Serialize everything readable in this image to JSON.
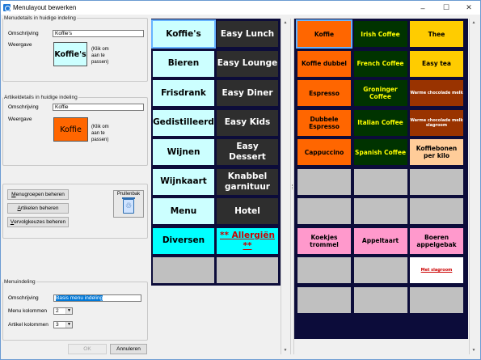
{
  "window": {
    "title": "Menulayout bewerken",
    "controls": {
      "minimize": "–",
      "maximize": "☐",
      "close": "✕"
    }
  },
  "menu_details": {
    "legend": "Menudetails in huidige indeling",
    "description_label": "Omschrijving",
    "description_value": "Koffie's",
    "display_label": "Weergave",
    "preview_text": "Koffie's",
    "hint": "(Klik om aan te passen)"
  },
  "article_details": {
    "legend": "Artikeldetails in huidige indeling",
    "description_label": "Omschrijving",
    "description_value": "Koffie",
    "display_label": "Weergave",
    "preview_text": "Koffie",
    "hint": "(Klik om aan te passen)"
  },
  "manage": {
    "menu_groups_button": "Menugroepen beheren",
    "menu_groups_mnemonic": "M",
    "articles_button": "Artikelen beheren",
    "articles_mnemonic": "A",
    "followup_button": "Vervolgkeuzes beheren",
    "followup_mnemonic": "V",
    "trash_label": "Prullenbak"
  },
  "menu_layout": {
    "legend": "Menuindeling",
    "description_label": "Omschrijving",
    "description_value": "Basis menu indeling",
    "menu_columns_label": "Menu kolommen",
    "menu_columns_value": "2",
    "article_columns_label": "Artikel kolommen",
    "article_columns_value": "3"
  },
  "footer": {
    "ok_label": "OK",
    "cancel_label": "Annuleren"
  },
  "menu_groups": [
    {
      "label": "Koffie's",
      "bg": "#ccffff",
      "fg": "#000000",
      "selected": true
    },
    {
      "label": "Easy Lunch",
      "bg": "#2e2e2e",
      "fg": "#ffffff"
    },
    {
      "label": "Bieren",
      "bg": "#ccffff",
      "fg": "#000000"
    },
    {
      "label": "Easy Lounge",
      "bg": "#2e2e2e",
      "fg": "#ffffff"
    },
    {
      "label": "Frisdrank",
      "bg": "#ccffff",
      "fg": "#000000"
    },
    {
      "label": "Easy Diner",
      "bg": "#2e2e2e",
      "fg": "#ffffff"
    },
    {
      "label": "Gedistilleerd",
      "bg": "#ccffff",
      "fg": "#000000"
    },
    {
      "label": "Easy Kids",
      "bg": "#2e2e2e",
      "fg": "#ffffff"
    },
    {
      "label": "Wijnen",
      "bg": "#ccffff",
      "fg": "#000000"
    },
    {
      "label": "Easy Dessert",
      "bg": "#2e2e2e",
      "fg": "#ffffff"
    },
    {
      "label": "Wijnkaart",
      "bg": "#ccffff",
      "fg": "#000000"
    },
    {
      "label": "Knabbel garnituur",
      "bg": "#2e2e2e",
      "fg": "#ffffff"
    },
    {
      "label": "Menu",
      "bg": "#ccffff",
      "fg": "#000000"
    },
    {
      "label": "Hotel",
      "bg": "#2e2e2e",
      "fg": "#ffffff"
    },
    {
      "label": "Diversen",
      "bg": "#00ffff",
      "fg": "#000000"
    },
    {
      "label": "** Allergiën **",
      "bg": "#00ffff",
      "fg": "#cc0000",
      "underline": true
    },
    {
      "label": "",
      "bg": "#c0c0c0",
      "fg": "#000000"
    },
    {
      "label": "",
      "bg": "#c0c0c0",
      "fg": "#000000"
    }
  ],
  "articles": [
    {
      "label": "Koffie",
      "bg": "#ff6600",
      "fg": "#000000",
      "selected": true
    },
    {
      "label": "Irish Coffee",
      "bg": "#003300",
      "fg": "#ffff00"
    },
    {
      "label": "Thee",
      "bg": "#ffcc00",
      "fg": "#000000"
    },
    {
      "label": "Koffie dubbel",
      "bg": "#ff6600",
      "fg": "#000000"
    },
    {
      "label": "French Coffee",
      "bg": "#003300",
      "fg": "#ffff00"
    },
    {
      "label": "Easy tea",
      "bg": "#ffcc00",
      "fg": "#000000"
    },
    {
      "label": "Espresso",
      "bg": "#ff6600",
      "fg": "#000000"
    },
    {
      "label": "Groninger Coffee",
      "bg": "#003300",
      "fg": "#ffff00"
    },
    {
      "label": "Warme chocolade melk",
      "bg": "#993300",
      "fg": "#ffffff",
      "small": true
    },
    {
      "label": "Dubbele Espresso",
      "bg": "#ff6600",
      "fg": "#000000"
    },
    {
      "label": "Italian Coffee",
      "bg": "#003300",
      "fg": "#ffff00"
    },
    {
      "label": "Warme chocolade melk slagroom",
      "bg": "#993300",
      "fg": "#ffffff",
      "small": true
    },
    {
      "label": "Cappuccino",
      "bg": "#ff6600",
      "fg": "#000000"
    },
    {
      "label": "Spanish Coffee",
      "bg": "#003300",
      "fg": "#ffff00"
    },
    {
      "label": "Koffiebonen per kilo",
      "bg": "#ffcc99",
      "fg": "#000000"
    },
    {
      "label": "",
      "bg": "#c0c0c0",
      "fg": "#000000"
    },
    {
      "label": "",
      "bg": "#c0c0c0",
      "fg": "#000000"
    },
    {
      "label": "",
      "bg": "#c0c0c0",
      "fg": "#000000"
    },
    {
      "label": "",
      "bg": "#c0c0c0",
      "fg": "#000000"
    },
    {
      "label": "",
      "bg": "#c0c0c0",
      "fg": "#000000"
    },
    {
      "label": "",
      "bg": "#c0c0c0",
      "fg": "#000000"
    },
    {
      "label": "Koekjes trommel",
      "bg": "#ff99cc",
      "fg": "#000000"
    },
    {
      "label": "Appeltaart",
      "bg": "#ff99cc",
      "fg": "#000000"
    },
    {
      "label": "Boeren appelgebak",
      "bg": "#ff99cc",
      "fg": "#000000"
    },
    {
      "label": "",
      "bg": "#c0c0c0",
      "fg": "#000000"
    },
    {
      "label": "",
      "bg": "#c0c0c0",
      "fg": "#000000"
    },
    {
      "label": "Met slagroom",
      "bg": "#ffffff",
      "fg": "#cc0000",
      "underline": true,
      "small": true
    },
    {
      "label": "",
      "bg": "#c0c0c0",
      "fg": "#000000"
    },
    {
      "label": "",
      "bg": "#c0c0c0",
      "fg": "#000000"
    },
    {
      "label": "",
      "bg": "#c0c0c0",
      "fg": "#000000"
    }
  ],
  "colors": {
    "panel_bg": "#0c0c3a",
    "selection": "#0078d7",
    "accent": "#1e78d7"
  }
}
